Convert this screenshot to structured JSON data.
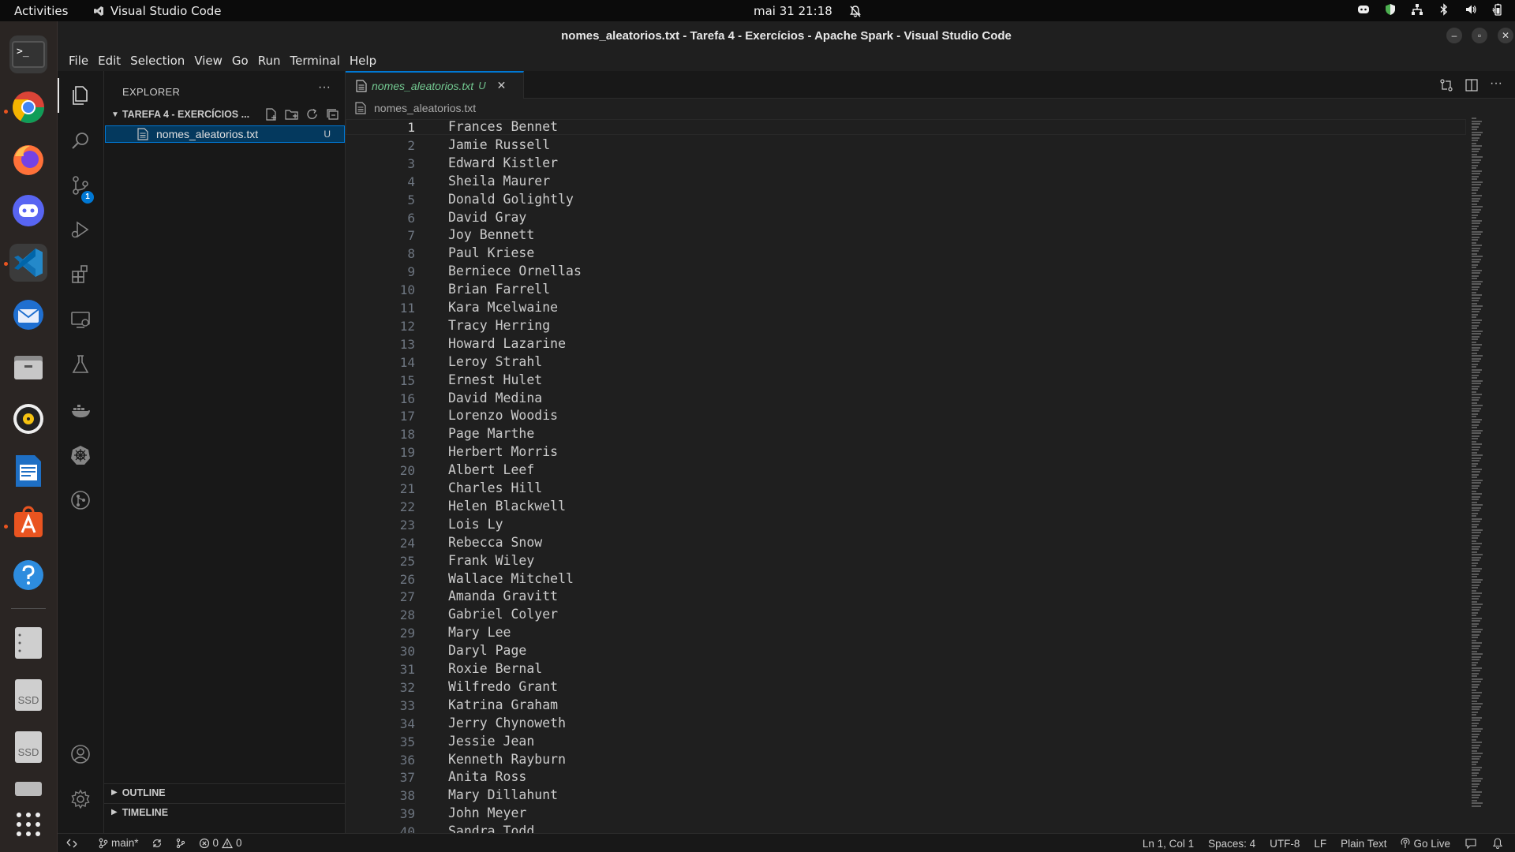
{
  "topbar": {
    "activities": "Activities",
    "app_name": "Visual Studio Code",
    "clock": "mai 31  21:18"
  },
  "window": {
    "title": "nomes_aleatorios.txt - Tarefa 4 - Exercícios - Apache Spark - Visual Studio Code"
  },
  "menu": [
    "File",
    "Edit",
    "Selection",
    "View",
    "Go",
    "Run",
    "Terminal",
    "Help"
  ],
  "activity_bar": {
    "source_control_badge": "1"
  },
  "sidebar": {
    "header": "EXPLORER",
    "folder": "TAREFA 4 - EXERCÍCIOS ...",
    "file": {
      "name": "nomes_aleatorios.txt",
      "status": "U"
    },
    "outline": "OUTLINE",
    "timeline": "TIMELINE"
  },
  "tab": {
    "name": "nomes_aleatorios.txt",
    "status": "U"
  },
  "breadcrumb": "nomes_aleatorios.txt",
  "lines": [
    "Frances Bennet",
    "Jamie Russell",
    "Edward Kistler",
    "Sheila Maurer",
    "Donald Golightly",
    "David Gray",
    "Joy Bennett",
    "Paul Kriese",
    "Berniece Ornellas",
    "Brian Farrell",
    "Kara Mcelwaine",
    "Tracy Herring",
    "Howard Lazarine",
    "Leroy Strahl",
    "Ernest Hulet",
    "David Medina",
    "Lorenzo Woodis",
    "Page Marthe",
    "Herbert Morris",
    "Albert Leef",
    "Charles Hill",
    "Helen Blackwell",
    "Lois Ly",
    "Rebecca Snow",
    "Frank Wiley",
    "Wallace Mitchell",
    "Amanda Gravitt",
    "Gabriel Colyer",
    "Mary Lee",
    "Daryl Page",
    "Roxie Bernal",
    "Wilfredo Grant",
    "Katrina Graham",
    "Jerry Chynoweth",
    "Jessie Jean",
    "Kenneth Rayburn",
    "Anita Ross",
    "Mary Dillahunt",
    "John Meyer",
    "Sandra Todd"
  ],
  "status": {
    "branch": "main*",
    "errors": "0",
    "warnings": "0",
    "position": "Ln 1, Col 1",
    "spaces": "Spaces: 4",
    "encoding": "UTF-8",
    "eol": "LF",
    "language": "Plain Text",
    "golive": "Go Live"
  },
  "colors": {
    "accent": "#0078d4",
    "untracked": "#73c991",
    "ubuntu_orange": "#e95420"
  }
}
